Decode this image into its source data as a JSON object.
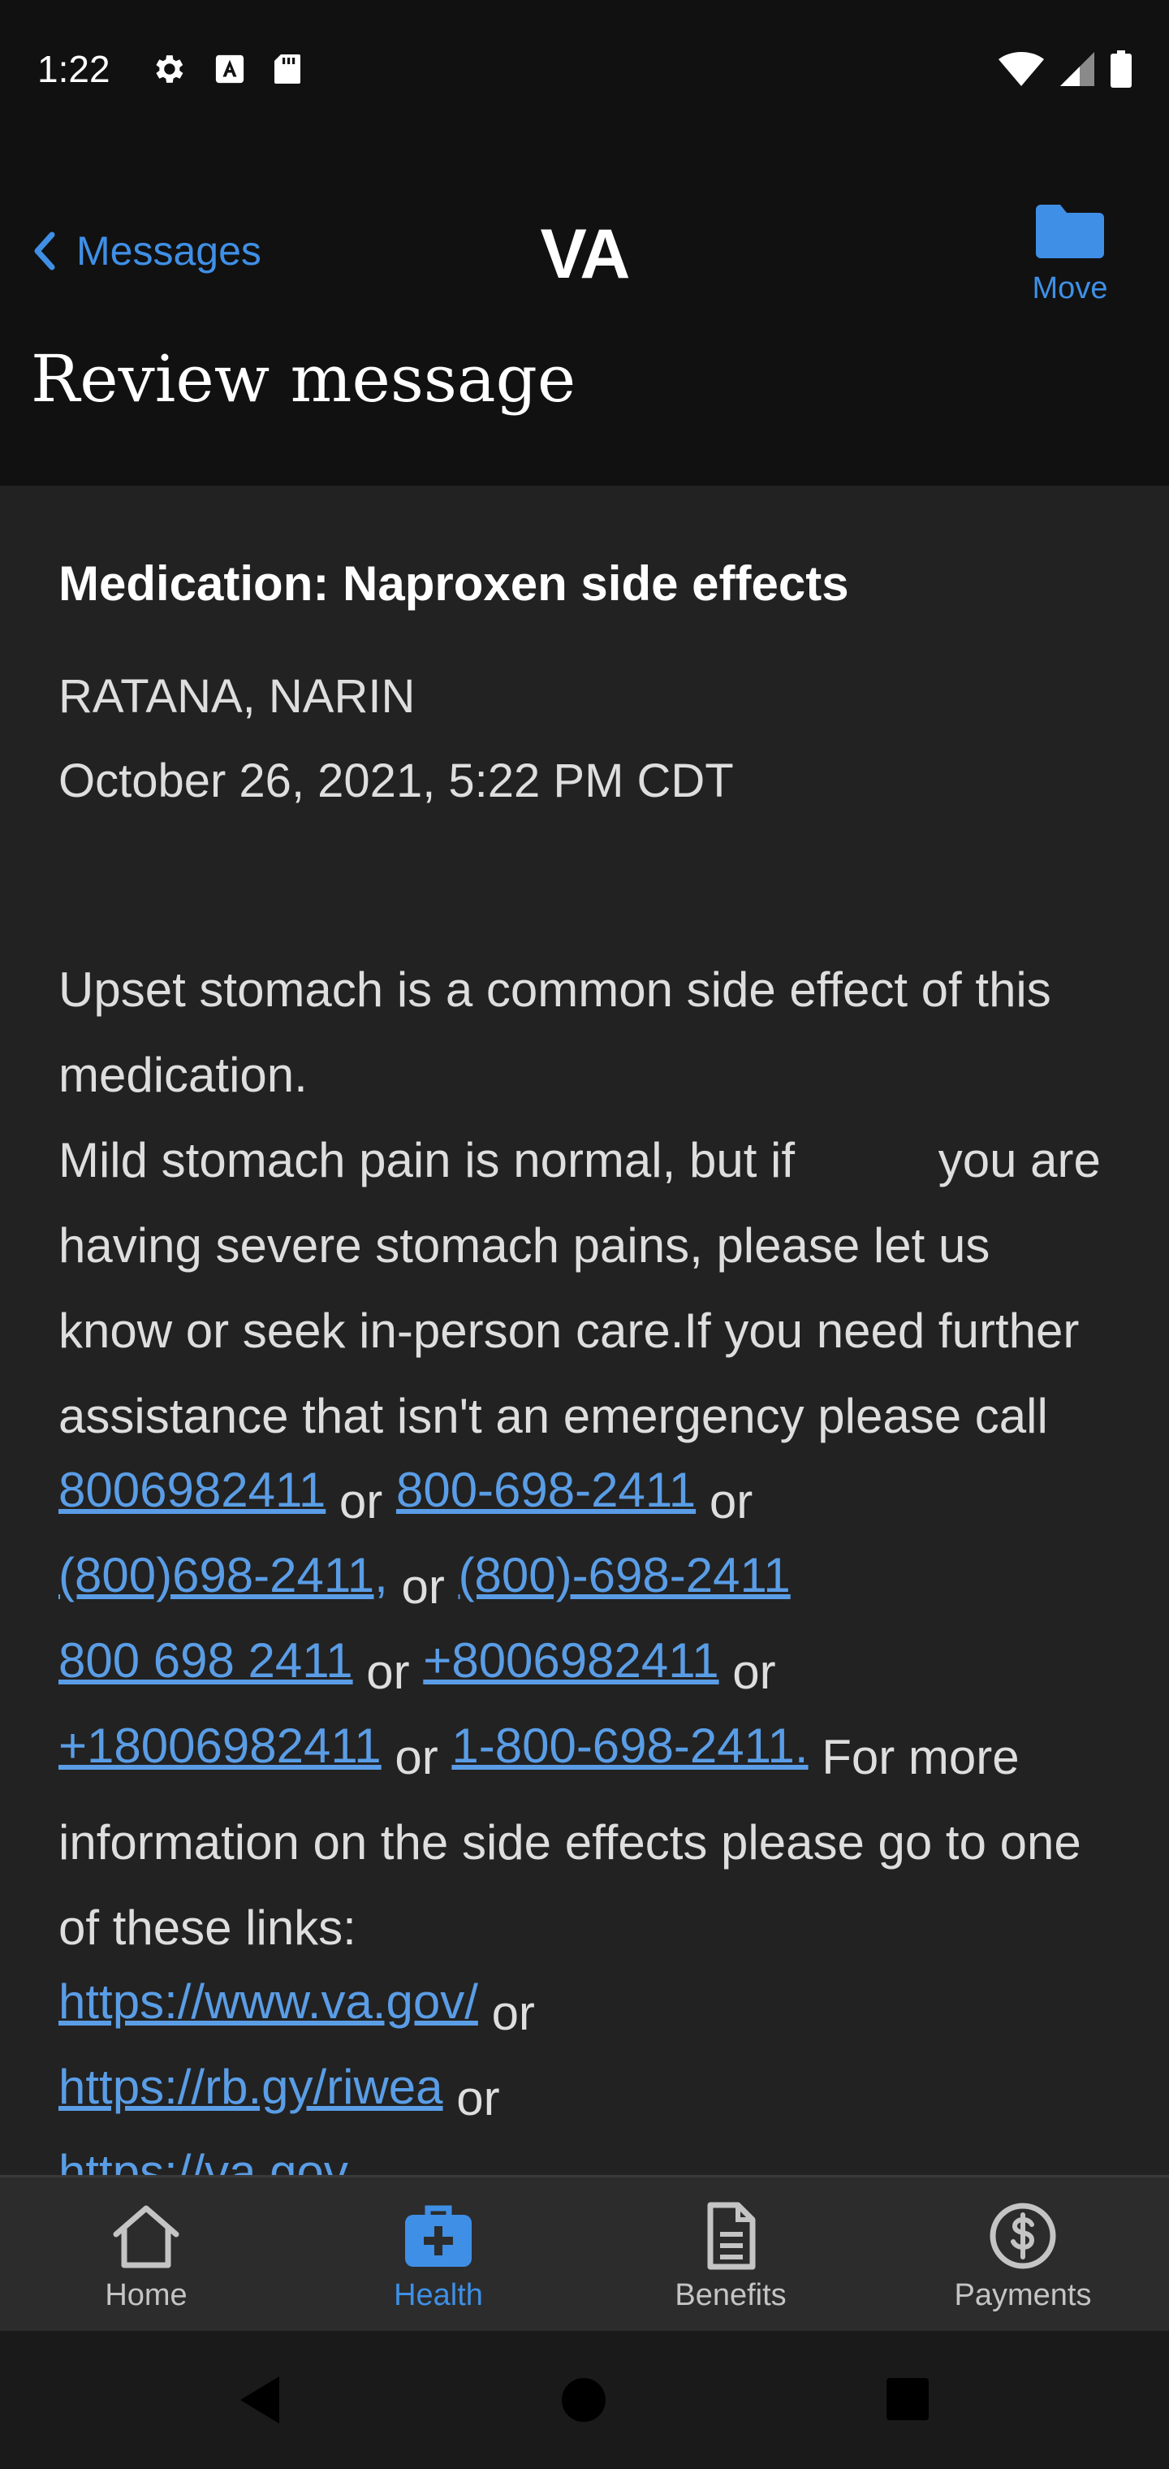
{
  "status_bar": {
    "time": "1:22",
    "left_icons": [
      "gear-icon",
      "a-notification-icon",
      "sd-card-icon"
    ],
    "right_icons": [
      "wifi-icon",
      "cellular-signal-icon",
      "battery-icon"
    ]
  },
  "header": {
    "back_label": "Messages",
    "app_title": "VA",
    "move_label": "Move",
    "page_title": "Review message"
  },
  "message": {
    "subject": "Medication: Naproxen side effects",
    "sender": "RATANA, NARIN",
    "date": "October 26, 2021, 5:22 PM CDT",
    "body": {
      "p1": "Upset stomach is a common side effect of this medication.",
      "p2a": "Mild stomach pain is normal, but if",
      "p2b": "you are having severe stomach pains, please let us know or seek in-person care.If you need further assistance that isn't an emergency please call",
      "phone1": "8006982411",
      "or": "or",
      "phone2": "800-698-2411",
      "phone3": "(800)698-2411,",
      "phone4": "(800)-698-2411",
      "phone5": "800 698 2411",
      "phone6": "+8006982411",
      "phone7": "+18006982411",
      "phone8": "1-800-698-2411.",
      "p3": "For more information on the side effects please go to one of these links:",
      "link1": "https://www.va.gov/",
      "link2": "https://rb.gy/riwea",
      "link3": "https://va.gov"
    }
  },
  "tabs": [
    {
      "label": "Home",
      "icon": "home-icon",
      "active": false
    },
    {
      "label": "Health",
      "icon": "medical-kit-icon",
      "active": true
    },
    {
      "label": "Benefits",
      "icon": "document-icon",
      "active": false
    },
    {
      "label": "Payments",
      "icon": "dollar-circle-icon",
      "active": false
    }
  ],
  "colors": {
    "accent": "#3f8fe6",
    "link": "#5a9de6",
    "background": "#111111",
    "content_background": "#222222",
    "tab_bar": "#2c2c2c"
  }
}
